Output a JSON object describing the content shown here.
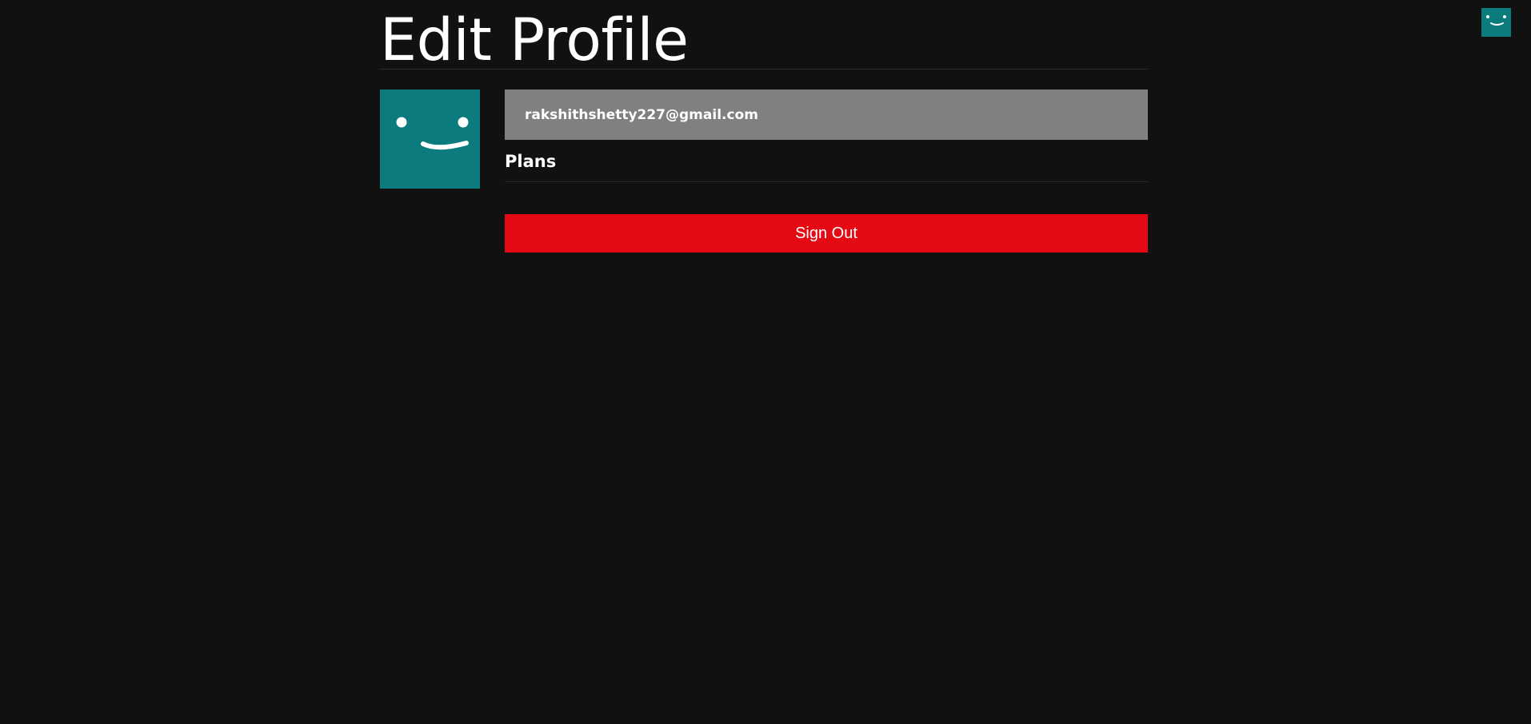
{
  "header": {
    "avatar_icon": "smiley-face-icon",
    "avatar_color": "#0b7b7e"
  },
  "main": {
    "title": "Edit Profile",
    "profile": {
      "avatar_icon": "smiley-face-icon",
      "avatar_color": "#0b7b7e",
      "email": "rakshithshetty227@gmail.com"
    },
    "plans": {
      "heading": "Plans"
    },
    "signout_label": "Sign Out"
  },
  "colors": {
    "background": "#111111",
    "accent_red": "#e50914",
    "email_box": "#808080",
    "divider": "#2b2b2b"
  }
}
